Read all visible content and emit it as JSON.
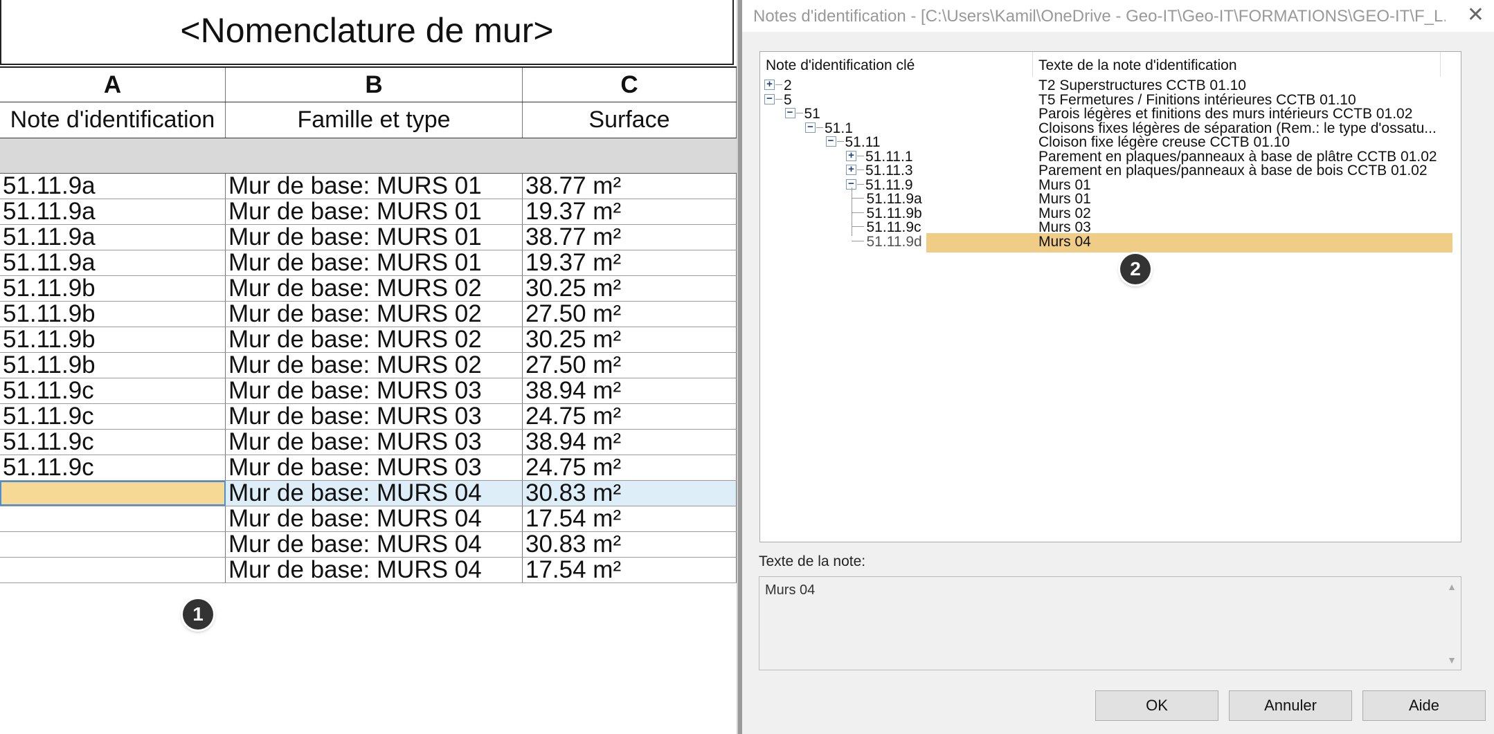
{
  "schedule": {
    "title": "<Nomenclature de mur>",
    "column_letters": [
      "A",
      "B",
      "C"
    ],
    "column_headers": [
      "Note d'identification",
      "Famille et type",
      "Surface"
    ],
    "rows": [
      {
        "note": "51.11.9a",
        "type": "Mur de base: MURS 01",
        "area": "38.77 m²"
      },
      {
        "note": "51.11.9a",
        "type": "Mur de base: MURS 01",
        "area": "19.37 m²"
      },
      {
        "note": "51.11.9a",
        "type": "Mur de base: MURS 01",
        "area": "38.77 m²"
      },
      {
        "note": "51.11.9a",
        "type": "Mur de base: MURS 01",
        "area": "19.37 m²"
      },
      {
        "note": "51.11.9b",
        "type": "Mur de base: MURS 02",
        "area": "30.25 m²"
      },
      {
        "note": "51.11.9b",
        "type": "Mur de base: MURS 02",
        "area": "27.50 m²"
      },
      {
        "note": "51.11.9b",
        "type": "Mur de base: MURS 02",
        "area": "30.25 m²"
      },
      {
        "note": "51.11.9b",
        "type": "Mur de base: MURS 02",
        "area": "27.50 m²"
      },
      {
        "note": "51.11.9c",
        "type": "Mur de base: MURS 03",
        "area": "38.94 m²"
      },
      {
        "note": "51.11.9c",
        "type": "Mur de base: MURS 03",
        "area": "24.75 m²"
      },
      {
        "note": "51.11.9c",
        "type": "Mur de base: MURS 03",
        "area": "38.94 m²"
      },
      {
        "note": "51.11.9c",
        "type": "Mur de base: MURS 03",
        "area": "24.75 m²"
      },
      {
        "note": "",
        "type": "Mur de base: MURS 04",
        "area": "30.83 m²"
      },
      {
        "note": "",
        "type": "Mur de base: MURS 04",
        "area": "17.54 m²"
      },
      {
        "note": "",
        "type": "Mur de base: MURS 04",
        "area": "30.83 m²"
      },
      {
        "note": "",
        "type": "Mur de base: MURS 04",
        "area": "17.54 m²"
      }
    ],
    "selected_row_index": 12,
    "badge_1": "1"
  },
  "dialog": {
    "title": "Notes d'identification - [C:\\Users\\Kamil\\OneDrive - Geo-IT\\Geo-IT\\FORMATIONS\\GEO-IT\\F_L...",
    "close_icon": "close-icon",
    "tree_headers": {
      "key": "Note d'identification clé",
      "text": "Texte de la note d'identification"
    },
    "tree": [
      {
        "key": "2",
        "text": "T2 Superstructures CCTB 01.10",
        "level": 0,
        "expander": "+"
      },
      {
        "key": "5",
        "text": "T5 Fermetures / Finitions intérieures CCTB 01.10",
        "level": 0,
        "expander": "−"
      },
      {
        "key": "51",
        "text": "Parois légères et finitions des murs intérieurs CCTB 01.02",
        "level": 1,
        "expander": "−"
      },
      {
        "key": "51.1",
        "text": "Cloisons fixes légères de séparation (Rem.: le type d'ossatu...",
        "level": 2,
        "expander": "−"
      },
      {
        "key": "51.11",
        "text": "Cloison fixe légère creuse CCTB 01.10",
        "level": 3,
        "expander": "−"
      },
      {
        "key": "51.11.1",
        "text": "Parement en plaques/panneaux à base de plâtre CCTB 01.02",
        "level": 4,
        "expander": "+"
      },
      {
        "key": "51.11.3",
        "text": "Parement en plaques/panneaux à base de bois CCTB 01.02",
        "level": 4,
        "expander": "+"
      },
      {
        "key": "51.11.9",
        "text": "Murs 01",
        "level": 4,
        "expander": "−"
      },
      {
        "key": "51.11.9a",
        "text": "Murs 01",
        "level": 5,
        "expander": ""
      },
      {
        "key": "51.11.9b",
        "text": "Murs 02",
        "level": 5,
        "expander": ""
      },
      {
        "key": "51.11.9c",
        "text": "Murs 03",
        "level": 5,
        "expander": ""
      },
      {
        "key": "51.11.9d",
        "text": "Murs 04",
        "level": 5,
        "expander": ""
      }
    ],
    "selected_tree_index": 11,
    "badge_2": "2",
    "note_label": "Texte de la note:",
    "note_text": "Murs 04",
    "buttons": {
      "ok": "OK",
      "cancel": "Annuler",
      "help": "Aide"
    },
    "colors": {
      "selection": "#f0cd87",
      "row_highlight": "#ddeef9"
    }
  }
}
